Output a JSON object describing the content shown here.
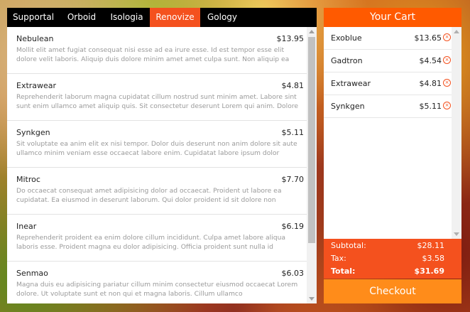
{
  "tabs": [
    {
      "label": "Supportal",
      "active": false
    },
    {
      "label": "Orboid",
      "active": false
    },
    {
      "label": "Isologia",
      "active": false
    },
    {
      "label": "Renovize",
      "active": true
    },
    {
      "label": "Gology",
      "active": false
    }
  ],
  "products": [
    {
      "name": "Nebulean",
      "price": "$13.95",
      "desc": "Mollit elit amet fugiat consequat nisi esse ad ea irure esse. Id est tempor esse elit dolore velit laboris. Aliquip duis dolore minim amet amet culpa sunt. Non aliquip ea ipsum sint"
    },
    {
      "name": "Extrawear",
      "price": "$4.81",
      "desc": "Reprehenderit laborum magna cupidatat cillum nostrud sunt minim amet. Labore sint sunt enim ullamco amet aliquip quis. Sit consectetur deserunt Lorem qui anim. Dolore"
    },
    {
      "name": "Synkgen",
      "price": "$5.11",
      "desc": "Sit voluptate ea anim elit ex nisi tempor. Dolor duis deserunt non anim dolore sit aute ullamco minim veniam esse occaecat labore enim. Cupidatat labore ipsum dolor"
    },
    {
      "name": "Mitroc",
      "price": "$7.70",
      "desc": "Do occaecat consequat amet adipisicing dolor ad occaecat. Proident ut labore ea cupidatat. Ea eiusmod in deserunt laborum. Qui dolor proident id sit dolore non"
    },
    {
      "name": "Inear",
      "price": "$6.19",
      "desc": "Reprehenderit proident ea enim dolore cillum incididunt. Culpa amet labore aliqua laboris esse. Proident magna eu dolor adipisicing. Officia proident sunt nulla id"
    },
    {
      "name": "Senmao",
      "price": "$6.03",
      "desc": "Magna duis eu adipisicing pariatur cillum minim consectetur eiusmod occaecat Lorem dolore. Ut voluptate sunt et non qui et magna laboris. Cillum ullamco"
    }
  ],
  "cart": {
    "title": "Your Cart",
    "items": [
      {
        "name": "Exoblue",
        "price": "$13.65"
      },
      {
        "name": "Gadtron",
        "price": "$4.54"
      },
      {
        "name": "Extrawear",
        "price": "$4.81"
      },
      {
        "name": "Synkgen",
        "price": "$5.11"
      }
    ],
    "remove_glyph": "×",
    "subtotal_label": "Subtotal:",
    "subtotal": "$28.11",
    "tax_label": "Tax:",
    "tax": "$3.58",
    "total_label": "Total:",
    "total": "$31.69",
    "checkout_label": "Checkout"
  },
  "colors": {
    "accent": "#f4511e",
    "cart_header": "#ff5a00",
    "checkout": "#ff8c1a",
    "tabbar": "#000000"
  }
}
